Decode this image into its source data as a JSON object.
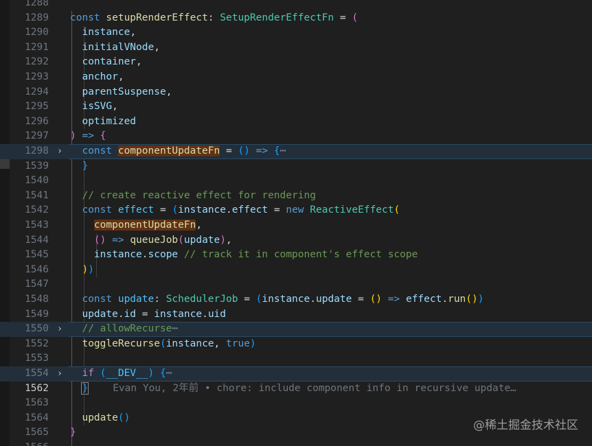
{
  "editor": {
    "lines": [
      {
        "num": "1288",
        "fold": "",
        "hl": false,
        "active": false,
        "tokens": []
      },
      {
        "num": "1289",
        "fold": "",
        "hl": false,
        "active": false,
        "tokens": [
          {
            "t": "const ",
            "c": "kw"
          },
          {
            "t": "setupRenderEffect",
            "c": "fn"
          },
          {
            "t": ": ",
            "c": "op"
          },
          {
            "t": "SetupRenderEffectFn",
            "c": "ty"
          },
          {
            "t": " = ",
            "c": "op"
          },
          {
            "t": "(",
            "c": "b2"
          }
        ]
      },
      {
        "num": "1290",
        "fold": "",
        "hl": false,
        "active": false,
        "tokens": [
          {
            "t": "  instance",
            "c": "var"
          },
          {
            "t": ",",
            "c": "op"
          }
        ]
      },
      {
        "num": "1291",
        "fold": "",
        "hl": false,
        "active": false,
        "tokens": [
          {
            "t": "  initialVNode",
            "c": "var"
          },
          {
            "t": ",",
            "c": "op"
          }
        ]
      },
      {
        "num": "1292",
        "fold": "",
        "hl": false,
        "active": false,
        "tokens": [
          {
            "t": "  container",
            "c": "var"
          },
          {
            "t": ",",
            "c": "op"
          }
        ]
      },
      {
        "num": "1293",
        "fold": "",
        "hl": false,
        "active": false,
        "tokens": [
          {
            "t": "  anchor",
            "c": "var"
          },
          {
            "t": ",",
            "c": "op"
          }
        ]
      },
      {
        "num": "1294",
        "fold": "",
        "hl": false,
        "active": false,
        "tokens": [
          {
            "t": "  parentSuspense",
            "c": "var"
          },
          {
            "t": ",",
            "c": "op"
          }
        ]
      },
      {
        "num": "1295",
        "fold": "",
        "hl": false,
        "active": false,
        "tokens": [
          {
            "t": "  isSVG",
            "c": "var"
          },
          {
            "t": ",",
            "c": "op"
          }
        ]
      },
      {
        "num": "1296",
        "fold": "",
        "hl": false,
        "active": false,
        "tokens": [
          {
            "t": "  optimized",
            "c": "var"
          }
        ]
      },
      {
        "num": "1297",
        "fold": "",
        "hl": false,
        "active": false,
        "tokens": [
          {
            "t": ")",
            "c": "b2"
          },
          {
            "t": " => ",
            "c": "kw"
          },
          {
            "t": "{",
            "c": "b2"
          }
        ]
      },
      {
        "num": "1298",
        "fold": ">",
        "hl": true,
        "active": false,
        "tokens": [
          {
            "t": "  const ",
            "c": "kw"
          },
          {
            "t": "componentUpdateFn",
            "c": "fn hlword"
          },
          {
            "t": " = ",
            "c": "op"
          },
          {
            "t": "()",
            "c": "b3"
          },
          {
            "t": " => ",
            "c": "kw"
          },
          {
            "t": "{",
            "c": "b3"
          },
          {
            "t": "⋯",
            "c": "ellipsis"
          }
        ]
      },
      {
        "num": "1539",
        "fold": "",
        "hl": false,
        "active": false,
        "tokens": [
          {
            "t": "  }",
            "c": "b3"
          }
        ]
      },
      {
        "num": "1540",
        "fold": "",
        "hl": false,
        "active": false,
        "tokens": []
      },
      {
        "num": "1541",
        "fold": "",
        "hl": false,
        "active": false,
        "tokens": [
          {
            "t": "  // create reactive effect for rendering",
            "c": "cmt"
          }
        ]
      },
      {
        "num": "1542",
        "fold": "",
        "hl": false,
        "active": false,
        "tokens": [
          {
            "t": "  const ",
            "c": "kw"
          },
          {
            "t": "effect",
            "c": "cst"
          },
          {
            "t": " = ",
            "c": "op"
          },
          {
            "t": "(",
            "c": "b3"
          },
          {
            "t": "instance",
            "c": "var"
          },
          {
            "t": ".",
            "c": "op"
          },
          {
            "t": "effect",
            "c": "var"
          },
          {
            "t": " = ",
            "c": "op"
          },
          {
            "t": "new ",
            "c": "kw"
          },
          {
            "t": "ReactiveEffect",
            "c": "ty"
          },
          {
            "t": "(",
            "c": "b1"
          }
        ]
      },
      {
        "num": "1543",
        "fold": "",
        "hl": false,
        "active": false,
        "tokens": [
          {
            "t": "    ",
            "c": "op"
          },
          {
            "t": "componentUpdateFn",
            "c": "fn hlword"
          },
          {
            "t": ",",
            "c": "op"
          }
        ]
      },
      {
        "num": "1544",
        "fold": "",
        "hl": false,
        "active": false,
        "tokens": [
          {
            "t": "    ",
            "c": "op"
          },
          {
            "t": "()",
            "c": "b2"
          },
          {
            "t": " => ",
            "c": "kw"
          },
          {
            "t": "queueJob",
            "c": "fn"
          },
          {
            "t": "(",
            "c": "b2"
          },
          {
            "t": "update",
            "c": "var"
          },
          {
            "t": ")",
            "c": "b2"
          },
          {
            "t": ",",
            "c": "op"
          }
        ]
      },
      {
        "num": "1545",
        "fold": "",
        "hl": false,
        "active": false,
        "tokens": [
          {
            "t": "    instance",
            "c": "var"
          },
          {
            "t": ".",
            "c": "op"
          },
          {
            "t": "scope",
            "c": "var"
          },
          {
            "t": " // track it in component's effect scope",
            "c": "cmt"
          }
        ]
      },
      {
        "num": "1546",
        "fold": "",
        "hl": false,
        "active": false,
        "tokens": [
          {
            "t": "  ",
            "c": "op"
          },
          {
            "t": ")",
            "c": "b1"
          },
          {
            "t": ")",
            "c": "b3"
          }
        ]
      },
      {
        "num": "1547",
        "fold": "",
        "hl": false,
        "active": false,
        "tokens": []
      },
      {
        "num": "1548",
        "fold": "",
        "hl": false,
        "active": false,
        "tokens": [
          {
            "t": "  const ",
            "c": "kw"
          },
          {
            "t": "update",
            "c": "cst"
          },
          {
            "t": ": ",
            "c": "op"
          },
          {
            "t": "SchedulerJob",
            "c": "ty"
          },
          {
            "t": " = ",
            "c": "op"
          },
          {
            "t": "(",
            "c": "b3"
          },
          {
            "t": "instance",
            "c": "var"
          },
          {
            "t": ".",
            "c": "op"
          },
          {
            "t": "update",
            "c": "var"
          },
          {
            "t": " = ",
            "c": "op"
          },
          {
            "t": "()",
            "c": "b1"
          },
          {
            "t": " => ",
            "c": "kw"
          },
          {
            "t": "effect",
            "c": "var"
          },
          {
            "t": ".",
            "c": "op"
          },
          {
            "t": "run",
            "c": "fn"
          },
          {
            "t": "()",
            "c": "b1"
          },
          {
            "t": ")",
            "c": "b3"
          }
        ]
      },
      {
        "num": "1549",
        "fold": "",
        "hl": false,
        "active": false,
        "tokens": [
          {
            "t": "  update",
            "c": "var"
          },
          {
            "t": ".",
            "c": "op"
          },
          {
            "t": "id",
            "c": "var"
          },
          {
            "t": " = ",
            "c": "op"
          },
          {
            "t": "instance",
            "c": "var"
          },
          {
            "t": ".",
            "c": "op"
          },
          {
            "t": "uid",
            "c": "var"
          }
        ]
      },
      {
        "num": "1550",
        "fold": ">",
        "hl": true,
        "active": false,
        "tokens": [
          {
            "t": "  // allowRecurse",
            "c": "cmt"
          },
          {
            "t": "⋯",
            "c": "ellipsis"
          }
        ]
      },
      {
        "num": "1552",
        "fold": "",
        "hl": false,
        "active": false,
        "tokens": [
          {
            "t": "  toggleRecurse",
            "c": "fn"
          },
          {
            "t": "(",
            "c": "b3"
          },
          {
            "t": "instance",
            "c": "var"
          },
          {
            "t": ", ",
            "c": "op"
          },
          {
            "t": "true",
            "c": "kw"
          },
          {
            "t": ")",
            "c": "b3"
          }
        ]
      },
      {
        "num": "1553",
        "fold": "",
        "hl": false,
        "active": false,
        "tokens": []
      },
      {
        "num": "1554",
        "fold": ">",
        "hl": true,
        "active": false,
        "tokens": [
          {
            "t": "  if ",
            "c": "kw2"
          },
          {
            "t": "(",
            "c": "b3"
          },
          {
            "t": "__DEV__",
            "c": "cst"
          },
          {
            "t": ")",
            "c": "b3"
          },
          {
            "t": " ",
            "c": "op"
          },
          {
            "t": "{",
            "c": "b3"
          },
          {
            "t": "⋯",
            "c": "ellipsis"
          }
        ]
      },
      {
        "num": "1562",
        "fold": "",
        "hl": false,
        "active": true,
        "tokens": [
          {
            "t": "  ",
            "c": "op"
          },
          {
            "t": "}",
            "c": "b3 cursor-brace"
          },
          {
            "t": "Evan You, 2年前 • chore: include component info in recursive update…",
            "c": "blame"
          }
        ]
      },
      {
        "num": "1563",
        "fold": "",
        "hl": false,
        "active": false,
        "tokens": []
      },
      {
        "num": "1564",
        "fold": "",
        "hl": false,
        "active": false,
        "tokens": [
          {
            "t": "  update",
            "c": "fn"
          },
          {
            "t": "()",
            "c": "b3"
          }
        ]
      },
      {
        "num": "1565",
        "fold": "",
        "hl": false,
        "active": false,
        "tokens": [
          {
            "t": "}",
            "c": "b2"
          }
        ]
      },
      {
        "num": "1566",
        "fold": "",
        "hl": false,
        "active": false,
        "tokens": []
      }
    ]
  },
  "watermark": "@稀土掘金技术社区",
  "colors": {
    "background": "#1f1f1f",
    "keyword": "#569cd6",
    "function": "#dcdcaa",
    "type": "#4ec9b0",
    "comment": "#6a9955"
  }
}
